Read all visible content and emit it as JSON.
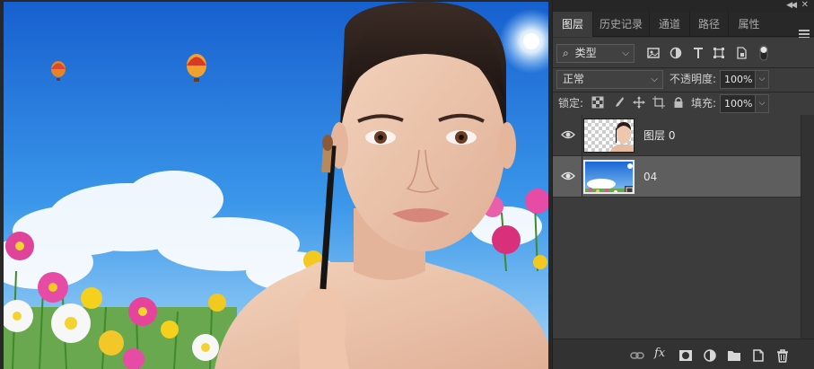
{
  "panel": {
    "tabs": [
      {
        "label": "图层",
        "active": true
      },
      {
        "label": "历史记录",
        "active": false
      },
      {
        "label": "通道",
        "active": false
      },
      {
        "label": "路径",
        "active": false
      },
      {
        "label": "属性",
        "active": false
      }
    ],
    "filter": {
      "search_glyph": "⌕",
      "kind_label": "类型"
    },
    "blend_mode": "正常",
    "opacity": {
      "label": "不透明度:",
      "value": "100%"
    },
    "lock_label": "锁定:",
    "fill": {
      "label": "填充:",
      "value": "100%"
    },
    "layers": [
      {
        "name": "图层 0",
        "visible": true,
        "selected": false
      },
      {
        "name": "04",
        "visible": true,
        "selected": true
      }
    ],
    "footer_icons": [
      "link-icon",
      "fx-icon",
      "mask-icon",
      "adjustment-icon",
      "folder-icon",
      "new-layer-icon",
      "trash-icon"
    ],
    "fx_label": "fx"
  },
  "colors": {
    "panel_bg": "#3c3c3c",
    "selected_row": "#5e5e5e",
    "sky_top": "#1b6fd8",
    "sky_bottom": "#7fc2f5"
  }
}
